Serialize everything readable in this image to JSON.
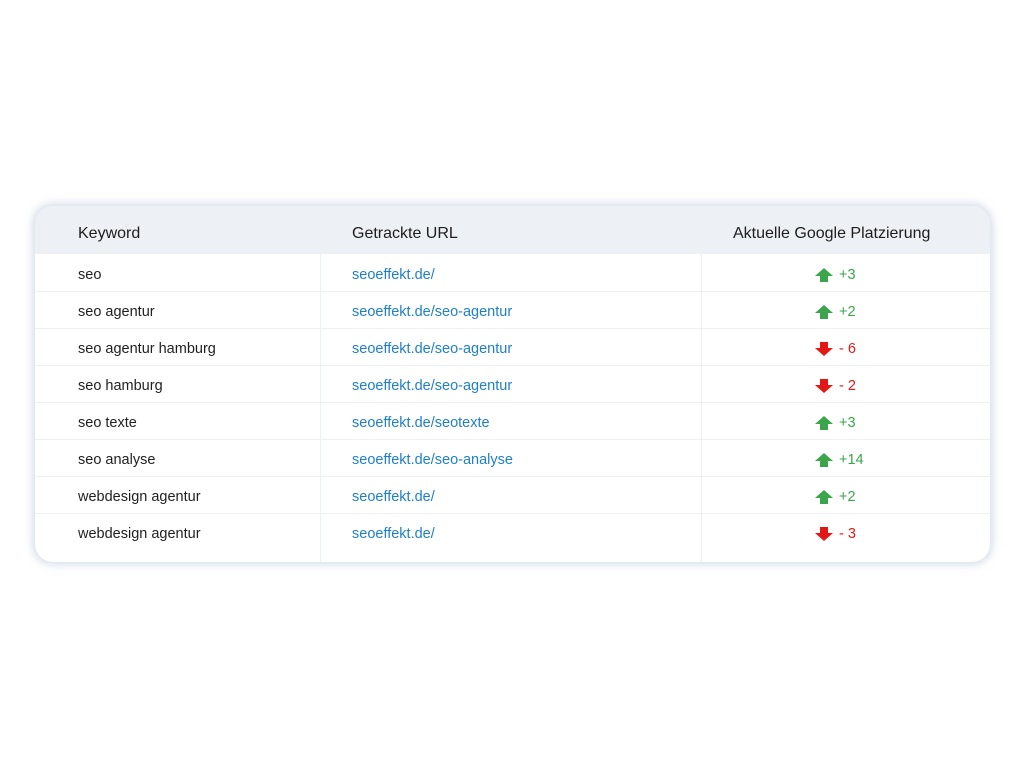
{
  "table": {
    "headers": {
      "keyword": "Keyword",
      "url": "Getrackte URL",
      "rank": "Aktuelle Google Platzierung"
    },
    "colors": {
      "up": "#3aa54a",
      "down": "#e41717",
      "link": "#1f7fc9"
    },
    "rows": [
      {
        "keyword": "seo",
        "url": "seoeffekt.de/",
        "direction": "up",
        "change": "+3"
      },
      {
        "keyword": "seo agentur",
        "url": "seoeffekt.de/seo-agentur",
        "direction": "up",
        "change": "+2"
      },
      {
        "keyword": "seo agentur hamburg",
        "url": "seoeffekt.de/seo-agentur",
        "direction": "down",
        "change": "- 6"
      },
      {
        "keyword": "seo hamburg",
        "url": "seoeffekt.de/seo-agentur",
        "direction": "down",
        "change": "- 2"
      },
      {
        "keyword": "seo texte",
        "url": "seoeffekt.de/seotexte",
        "direction": "up",
        "change": "+3"
      },
      {
        "keyword": "seo analyse",
        "url": "seoeffekt.de/seo-analyse",
        "direction": "up",
        "change": "+14"
      },
      {
        "keyword": "webdesign agentur",
        "url": "seoeffekt.de/",
        "direction": "up",
        "change": "+2"
      },
      {
        "keyword": "webdesign agentur",
        "url": "seoeffekt.de/",
        "direction": "down",
        "change": "- 3"
      }
    ]
  }
}
